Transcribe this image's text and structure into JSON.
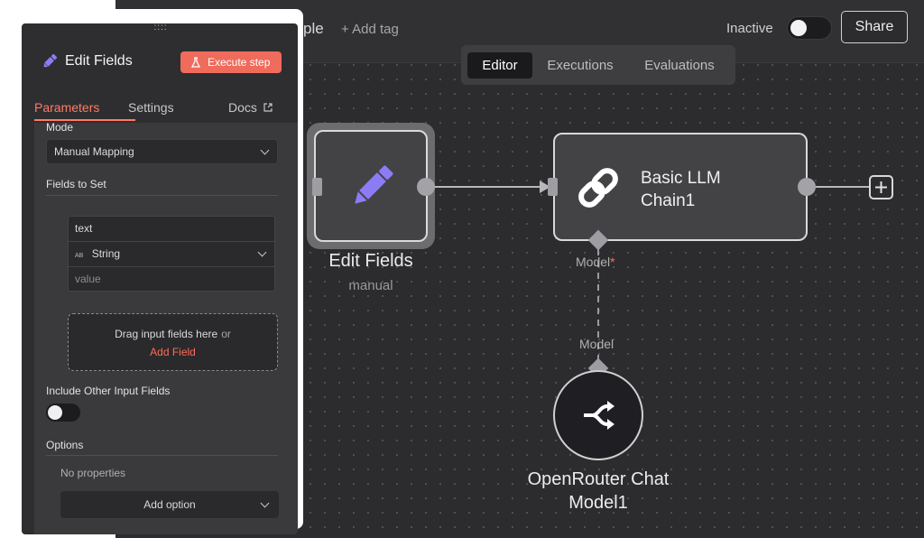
{
  "header": {
    "workflow_title_fragment": "ple",
    "add_tag_label": "+ Add tag",
    "status_label": "Inactive",
    "share_label": "Share"
  },
  "view_tabs": [
    {
      "label": "Editor",
      "active": true
    },
    {
      "label": "Executions",
      "active": false
    },
    {
      "label": "Evaluations",
      "active": false
    }
  ],
  "canvas": {
    "edit_node": {
      "title": "Edit Fields",
      "subtitle": "manual",
      "icon": "pencil-icon"
    },
    "llm_node": {
      "title_line1": "Basic LLM",
      "title_line2": "Chain1",
      "icon": "chain-link-icon"
    },
    "model_port_label": "Model",
    "model_required_mark": "*",
    "model_connector_label": "Model",
    "openrouter_node": {
      "title_line1": "OpenRouter Chat",
      "title_line2": "Model1",
      "icon": "openrouter-icon"
    },
    "add_node_icon": "plus-icon",
    "partial_texts": {
      "top": "P",
      "bottom": "e"
    }
  },
  "panel": {
    "title": "Edit Fields",
    "title_icon": "pencil-icon",
    "execute_label": "Execute step",
    "execute_icon": "flask-icon",
    "tabs": [
      {
        "label": "Parameters",
        "active": true
      },
      {
        "label": "Settings",
        "active": false
      },
      {
        "label": "Docs",
        "active": false,
        "icon": "external-link-icon"
      }
    ],
    "mode_label": "Mode",
    "mode_value": "Manual Mapping",
    "fields_to_set_label": "Fields to Set",
    "field": {
      "name": "text",
      "type_badge": "AB",
      "type": "String",
      "value_placeholder": "value"
    },
    "drop_text": "Drag input fields here",
    "drop_or": "or",
    "add_field_label": "Add Field",
    "include_other_label": "Include Other Input Fields",
    "include_other_enabled": false,
    "options_label": "Options",
    "no_properties_label": "No properties",
    "add_option_label": "Add option"
  },
  "colors": {
    "accent": "#ff6b57",
    "execute_button": "#ef6b5b",
    "canvas_bg": "#2c2c2e",
    "panel_bg": "#2e2e30",
    "node_icon_purple": "#8b7cf6"
  }
}
